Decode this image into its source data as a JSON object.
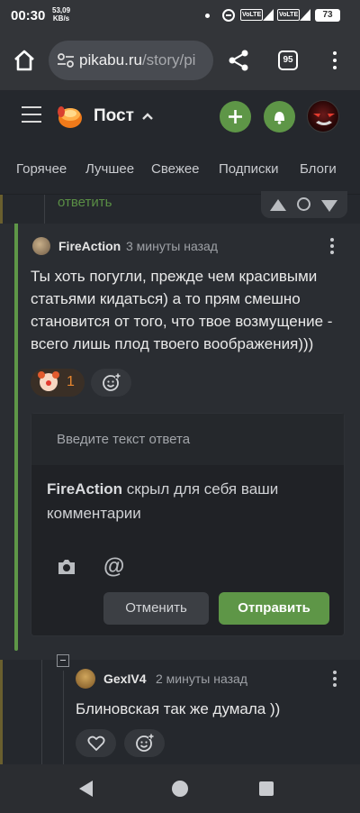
{
  "status_bar": {
    "time": "00:30",
    "speed_value": "53,09",
    "speed_unit": "KB/s",
    "volte_1": "VoLTE",
    "volte_2": "VoLTE",
    "battery": "73"
  },
  "browser": {
    "url_host": "pikabu.ru",
    "url_path": "/story/pi",
    "tabs_count": "95"
  },
  "header": {
    "title": "Пост"
  },
  "nav_tabs": [
    "Горячее",
    "Лучшее",
    "Свежее",
    "Подписки",
    "Блоги"
  ],
  "previous_comment": {
    "reply_label": "ответить"
  },
  "comment": {
    "author": "FireAction",
    "time": "3 минуты назад",
    "text": "Ты хоть погугли, прежде чем красивыми статьями кидаться) а то прям смешно становится от того, что твое возмущение - всего лишь плод твоего воображения)))",
    "reaction_count": "1"
  },
  "reply_form": {
    "placeholder": "Введите текст ответа",
    "notice_author": "FireAction",
    "notice_text": " скрыл для себя ваши комментарии",
    "at_symbol": "@",
    "cancel_label": "Отменить",
    "send_label": "Отправить"
  },
  "reply_comment": {
    "author": "GexIV4",
    "time": "2 минуты назад",
    "text": "Блиновская так же думала ))"
  },
  "colors": {
    "accent_green": "#5e9647",
    "background": "#25282d",
    "reaction_orange": "#e8862e"
  },
  "icons": [
    "home-icon",
    "tune-icon",
    "share-icon",
    "menu-icon",
    "plus-icon",
    "bell-icon",
    "camera-icon",
    "at-icon",
    "heart-icon",
    "add-reaction-icon",
    "clown-emoji-icon"
  ]
}
